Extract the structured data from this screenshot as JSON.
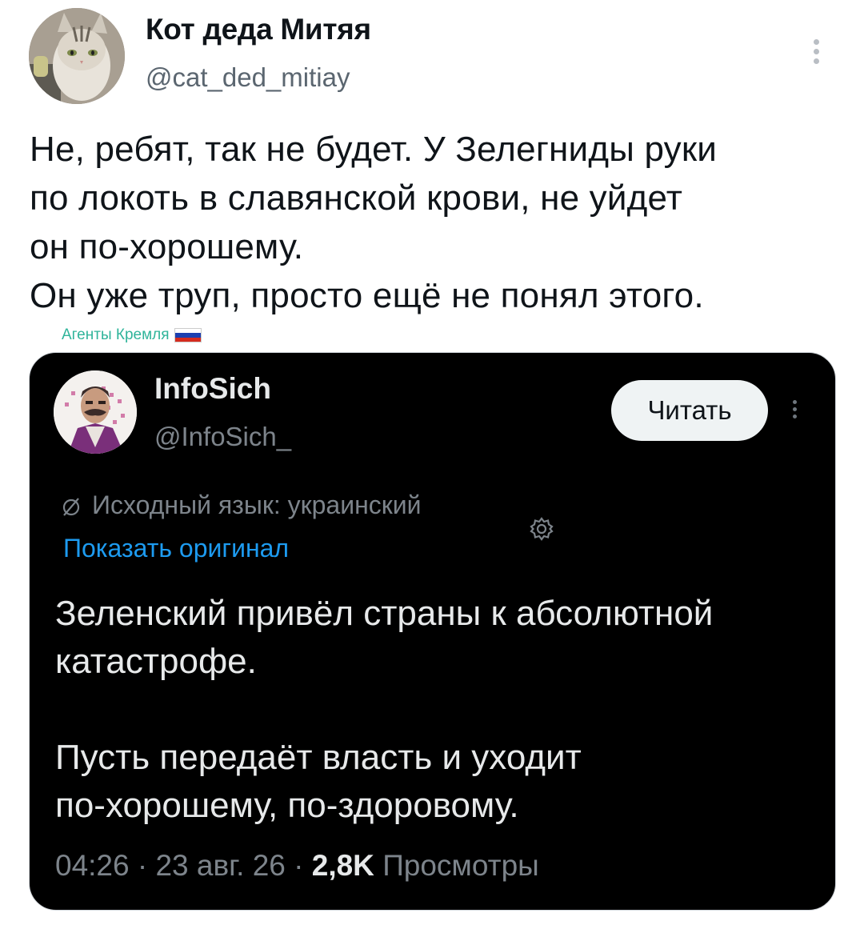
{
  "outer_tweet": {
    "author_name": "Кот деда Митяя",
    "author_handle": "@cat_ded_mitiay",
    "text": "Не, ребят, так не будет. У Зелегниды руки\nпо локоть в славянской крови, не уйдет\nон по-хорошему.\nОн уже труп, просто ещё не понял этого."
  },
  "watermark": {
    "label": "Агенты Кремля",
    "flag_colors": [
      "#ffffff",
      "#1c3fb0",
      "#d52b1e"
    ]
  },
  "quoted_tweet": {
    "author_name": "InfoSich",
    "author_handle": "@InfoSich_",
    "follow_label": "Читать",
    "translation_note": "Исходный язык: украинский",
    "show_original_label": "Показать оригинал",
    "text": "Зеленский привёл страны к абсолютной\nкатастрофе.\n\nПусть передаёт власть и уходит\nпо-хорошему, по-здоровому.",
    "time": "04:26",
    "date": "23 авг. 26",
    "views_count": "2,8K",
    "views_label": "Просмотры"
  },
  "icons": [
    "more-vertical-icon",
    "translate-icon",
    "gear-icon"
  ],
  "colors": {
    "link_blue": "#1d9bf0",
    "watermark_green": "#2fb49a",
    "dark_bg": "#000000",
    "muted_gray": "#7d848b"
  }
}
